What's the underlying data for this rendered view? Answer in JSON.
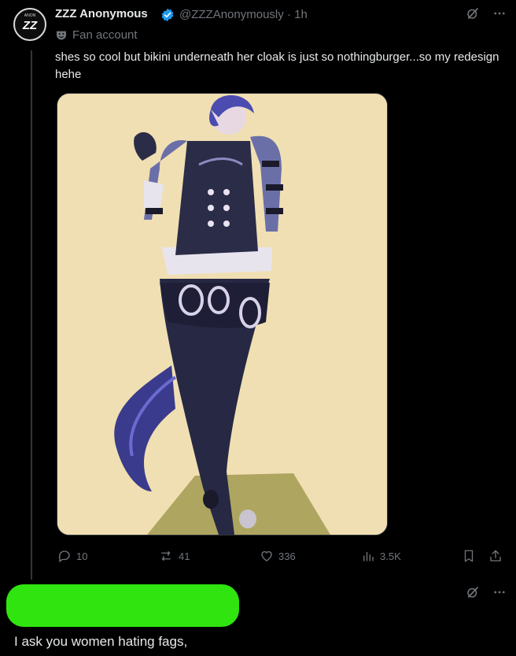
{
  "tweet": {
    "display_name": "ZZZ Anonymous",
    "handle": "@ZZZAnonymously",
    "separator": "·",
    "time": "1h",
    "label": "Fan account",
    "text": "shes so cool but bikini underneath her cloak is just so nothingburger...so my redesign hehe",
    "avatar_text": "ZZ",
    "avatar_ring_text": "ANON",
    "stats": {
      "replies": "10",
      "reposts": "41",
      "likes": "336",
      "views": "3.5K"
    }
  },
  "reply": {
    "text": "I ask you women hating fags,"
  },
  "colors": {
    "background": "#000000",
    "text": "#e7e9ea",
    "muted": "#71767b",
    "verified": "#1d9bf0",
    "redaction": "#2fe40f",
    "media_bg": "#f0dfb2"
  }
}
